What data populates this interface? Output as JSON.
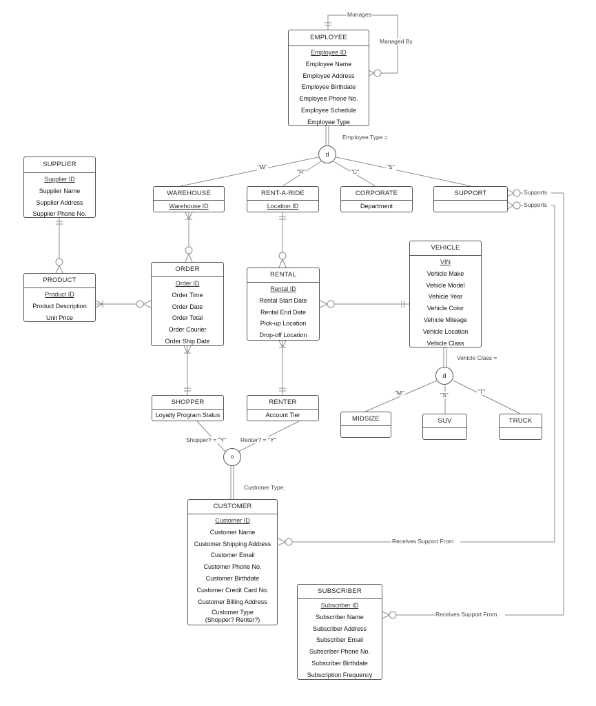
{
  "entities": {
    "employee": {
      "name": "EMPLOYEE",
      "pk": "Employee ID",
      "attrs": [
        "Employee Name",
        "Employee Address",
        "Employee Birthdate",
        "Employee Phone No.",
        "Employee Schedule",
        "Employee Type"
      ]
    },
    "supplier": {
      "name": "SUPPLIER",
      "pk": "Supplier ID",
      "attrs": [
        "Supplier Name",
        "Supplier Address",
        "Supplier Phone No."
      ]
    },
    "warehouse": {
      "name": "WAREHOUSE",
      "pk": "Warehouse ID",
      "attrs": []
    },
    "rent_a_ride": {
      "name": "RENT-A-RIDE",
      "pk": "Location ID",
      "attrs": []
    },
    "corporate": {
      "name": "CORPORATE",
      "pk": "",
      "attrs": [
        "Department"
      ]
    },
    "support": {
      "name": "SUPPORT",
      "pk": "",
      "attrs": []
    },
    "product": {
      "name": "PRODUCT",
      "pk": "Product ID",
      "attrs": [
        "Product Description",
        "Unit Price"
      ]
    },
    "order": {
      "name": "ORDER",
      "pk": "Order ID",
      "attrs": [
        "Order Time",
        "Order Date",
        "Order Total",
        "Order Courier",
        "Order Ship Date"
      ]
    },
    "rental": {
      "name": "RENTAL",
      "pk": "Rental ID",
      "attrs": [
        "Rental Start Date",
        "Rental End Date",
        "Pick-up Location",
        "Drop-off Location"
      ]
    },
    "vehicle": {
      "name": "VEHICLE",
      "pk": "VIN",
      "attrs": [
        "Vehicle Make",
        "Vehicle Model",
        "Vehicle Year",
        "Vehicle Color",
        "Vehicle Mileage",
        "Vehicle Location",
        "Vehicle Class"
      ]
    },
    "midsize": {
      "name": "MIDSIZE",
      "pk": "",
      "attrs": []
    },
    "suv": {
      "name": "SUV",
      "pk": "",
      "attrs": []
    },
    "truck": {
      "name": "TRUCK",
      "pk": "",
      "attrs": []
    },
    "shopper": {
      "name": "SHOPPER",
      "pk": "",
      "attrs": [
        "Loyalty Program Status"
      ]
    },
    "renter": {
      "name": "RENTER",
      "pk": "",
      "attrs": [
        "Account Tier"
      ]
    },
    "customer": {
      "name": "CUSTOMER",
      "pk": "Customer ID",
      "attrs": [
        "Customer Name",
        "Customer Shipping Address",
        "Customer Email",
        "Customer Phone No.",
        "Customer Birthdate",
        "Customer Credit Card No.",
        "Customer Billing Address"
      ],
      "multi_attr": [
        "Customer Type",
        "(Shopper? Renter?)"
      ]
    },
    "subscriber": {
      "name": "SUBSCRIBER",
      "pk": "Subscriber ID",
      "attrs": [
        "Subscriber Name",
        "Subscriber Address",
        "Subscriber Email",
        "Subscriber Phone No.",
        "Subscriber Birthdate",
        "Subscription Frequency"
      ]
    }
  },
  "relationships": {
    "manages": "Manages",
    "managed_by": "Managed By",
    "supports_1": "Supports",
    "supports_2": "Supports",
    "receives_support_customer": "Receives Support From",
    "receives_support_subscriber": "Receives Support From"
  },
  "specializations": {
    "employee": {
      "symbol": "d",
      "discriminator": "Employee Type =",
      "values": [
        "\"W\"",
        "\"R\"",
        "\"C\"",
        "\"S\""
      ]
    },
    "vehicle": {
      "symbol": "d",
      "discriminator": "Vehicle Class =",
      "values": [
        "\"M\"",
        "\"S\"",
        "\"T\""
      ]
    },
    "customer": {
      "symbol": "o",
      "discriminator": "Customer Type:",
      "values": [
        "Shopper? = \"Y\"",
        "Renter? = \"Y\""
      ]
    }
  }
}
